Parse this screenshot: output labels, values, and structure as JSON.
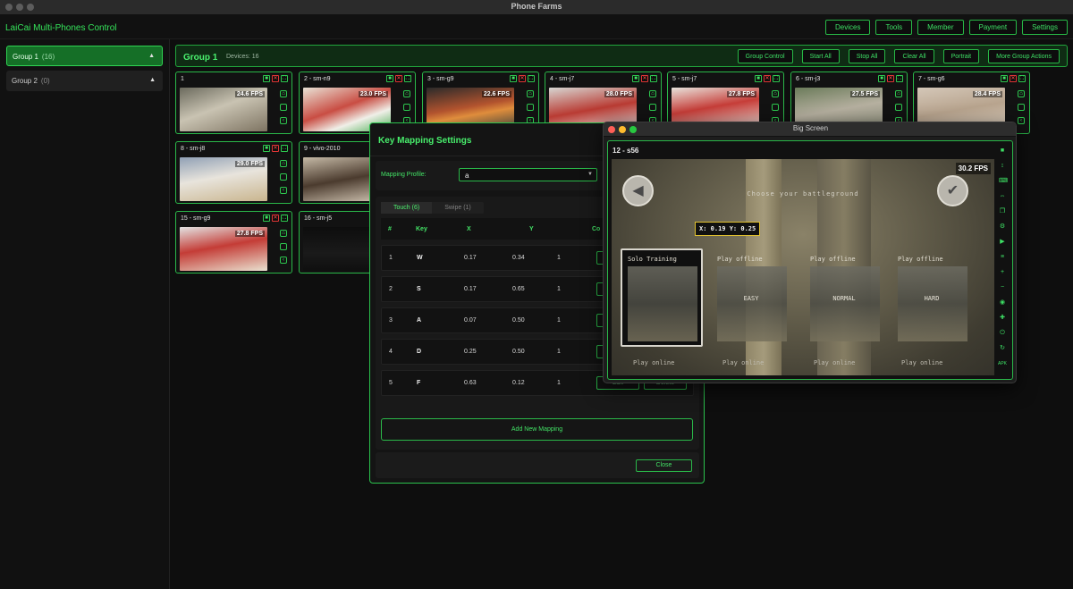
{
  "window_title": "Phone Farms",
  "app_name": "LaiCai Multi-Phones Control",
  "top_nav": [
    "Devices",
    "Tools",
    "Member",
    "Payment",
    "Settings"
  ],
  "sidebar": {
    "groups": [
      {
        "name": "Group 1",
        "count": "(16)",
        "active": true
      },
      {
        "name": "Group 2",
        "count": "(0)",
        "active": false
      }
    ]
  },
  "group": {
    "title": "Group 1",
    "devices_label": "Devices: 16",
    "actions": [
      "Group Control",
      "Start All",
      "Stop All",
      "Clear All",
      "Portrait",
      "More Group Actions"
    ]
  },
  "devices": [
    {
      "name": "1",
      "fps": "24.6 FPS"
    },
    {
      "name": "2 - sm-n9",
      "fps": "23.0 FPS"
    },
    {
      "name": "3 - sm-g9",
      "fps": "22.6 FPS"
    },
    {
      "name": "4 - sm-j7",
      "fps": "28.0 FPS"
    },
    {
      "name": "5 - sm-j7",
      "fps": "27.8 FPS"
    },
    {
      "name": "6 - sm-j3",
      "fps": "27.5 FPS"
    },
    {
      "name": "7 - sm-g6",
      "fps": "28.4 FPS"
    },
    {
      "name": "8 - sm-j8",
      "fps": "29.0 FPS"
    },
    {
      "name": "9 - vivo-2010",
      "fps": "28."
    },
    {
      "name": "15 - sm-g9",
      "fps": "27.8 FPS"
    },
    {
      "name": "16 - sm-j5",
      "fps": "17."
    }
  ],
  "key_mapping": {
    "title": "Key Mapping Settings",
    "profile_label": "Mapping Profile:",
    "profile_value": "a",
    "tabs": [
      "Touch (6)",
      "Swipe (1)"
    ],
    "columns": [
      "#",
      "Key",
      "X",
      "Y",
      "Co"
    ],
    "rows": [
      {
        "n": "1",
        "key": "W",
        "x": "0.17",
        "y": "0.34",
        "c": "1"
      },
      {
        "n": "2",
        "key": "S",
        "x": "0.17",
        "y": "0.65",
        "c": "1"
      },
      {
        "n": "3",
        "key": "A",
        "x": "0.07",
        "y": "0.50",
        "c": "1"
      },
      {
        "n": "4",
        "key": "D",
        "x": "0.25",
        "y": "0.50",
        "c": "1"
      },
      {
        "n": "5",
        "key": "F",
        "x": "0.63",
        "y": "0.12",
        "c": "1"
      }
    ],
    "row_edit": "Edit",
    "row_delete": "Delete",
    "add_label": "Add New Mapping",
    "close_label": "Close"
  },
  "big_screen": {
    "title": "Big Screen",
    "device_name": "12 - s56",
    "fps": "30.2 FPS",
    "heading": "Choose your battleground",
    "coord_label": "X: 0.19  Y: 0.25",
    "modes": [
      {
        "label": "Solo Training",
        "difficulty": ""
      },
      {
        "label": "Play offline",
        "difficulty": "EASY"
      },
      {
        "label": "Play offline",
        "difficulty": "NORMAL"
      },
      {
        "label": "Play offline",
        "difficulty": "HARD"
      }
    ],
    "online_label": "Play online",
    "apk_label": "APK"
  }
}
